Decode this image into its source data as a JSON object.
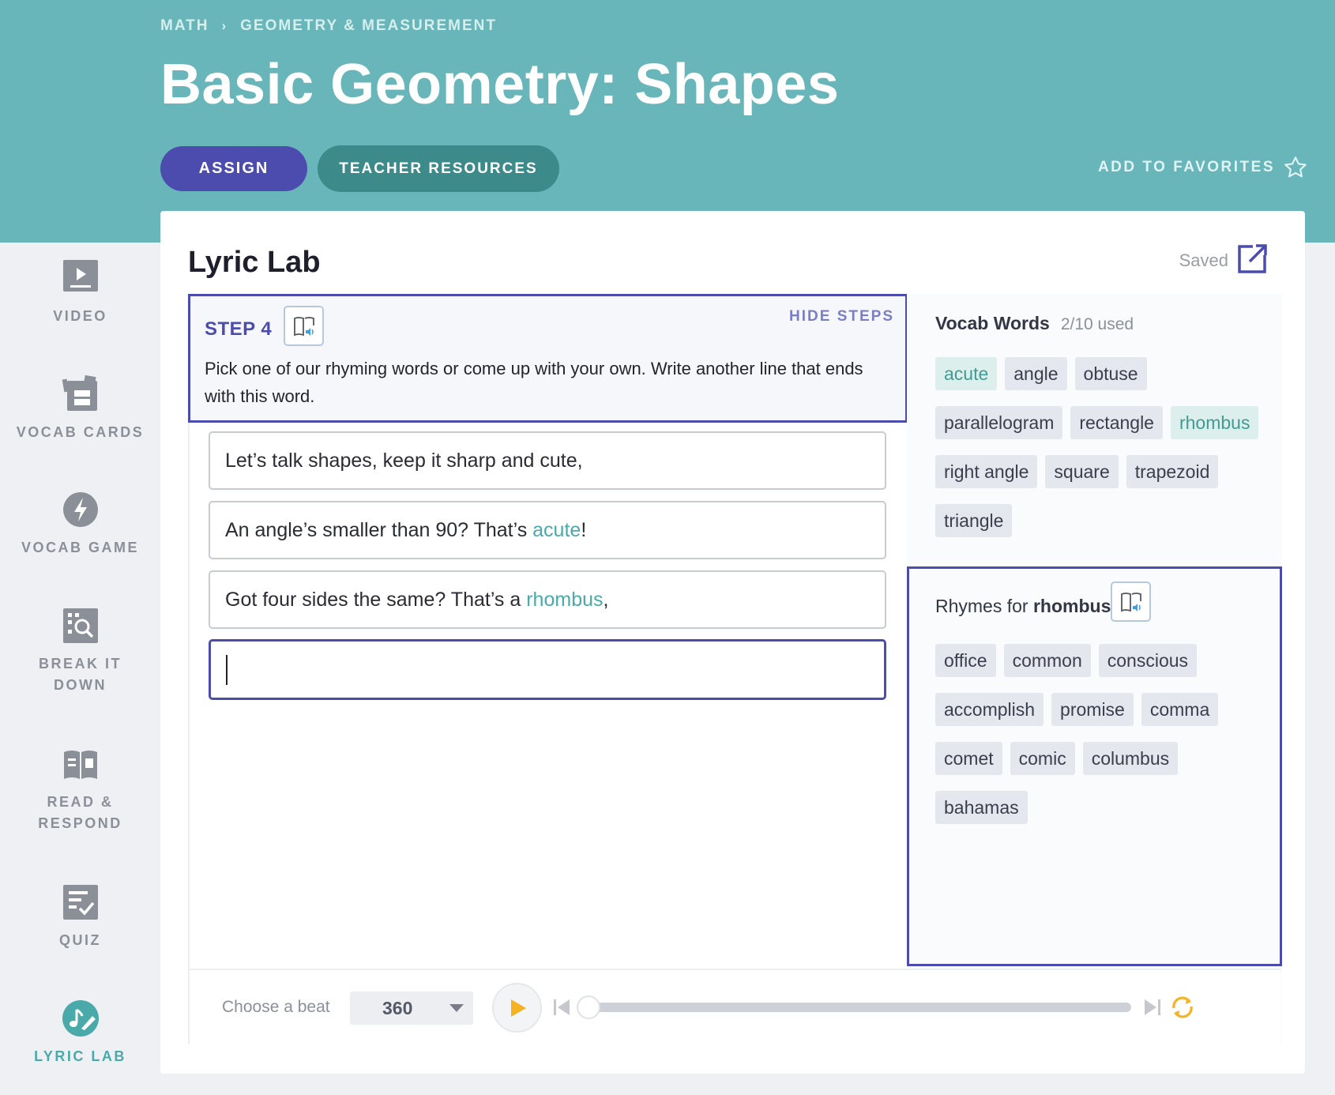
{
  "breadcrumb": {
    "items": [
      "MATH",
      "GEOMETRY & MEASUREMENT"
    ],
    "separator": "›"
  },
  "header": {
    "title": "Basic Geometry: Shapes",
    "assign_label": "ASSIGN",
    "resources_label": "TEACHER RESOURCES",
    "favorites_label": "ADD TO FAVORITES"
  },
  "sidebar": {
    "items": [
      {
        "label": "VIDEO",
        "icon": "video-icon"
      },
      {
        "label": "VOCAB CARDS",
        "icon": "vocab-cards-icon"
      },
      {
        "label": "VOCAB GAME",
        "icon": "lightning-icon"
      },
      {
        "label": "BREAK IT DOWN",
        "icon": "magnify-icon"
      },
      {
        "label": "READ & RESPOND",
        "icon": "book-icon"
      },
      {
        "label": "QUIZ",
        "icon": "quiz-icon"
      },
      {
        "label": "LYRIC LAB",
        "icon": "pen-music-icon",
        "active": true
      }
    ]
  },
  "card": {
    "title": "Lyric Lab",
    "saved_label": "Saved"
  },
  "step": {
    "label": "STEP 4",
    "hide_label": "HIDE STEPS",
    "text": "Pick one of our rhyming words or come up with your own. Write another line that ends with this word."
  },
  "lines": {
    "line1": "Let’s talk shapes, keep it sharp and cute,",
    "line2_pre": "An angle’s smaller than 90? That’s ",
    "line2_word": "acute",
    "line2_post": "!",
    "line3_pre": "Got four sides the same? That’s a ",
    "line3_word": "rhombus",
    "line3_post": ","
  },
  "vocab": {
    "title": "Vocab Words",
    "count": "2/10 used",
    "words": [
      "acute",
      "angle",
      "obtuse",
      "parallelogram",
      "rectangle",
      "rhombus",
      "right angle",
      "square",
      "trapezoid",
      "triangle"
    ],
    "used": [
      "acute",
      "rhombus"
    ]
  },
  "rhymes": {
    "prefix": "Rhymes for",
    "word": "rhombus",
    "words": [
      "office",
      "common",
      "conscious",
      "accomplish",
      "promise",
      "comma",
      "comet",
      "comic",
      "columbus",
      "bahamas"
    ]
  },
  "beat": {
    "label": "Choose a beat",
    "value": "360"
  },
  "colors": {
    "accent": "#4b4cae",
    "teal": "#68b6b9",
    "highlight": "#4aa9a9",
    "play": "#f5b324"
  }
}
